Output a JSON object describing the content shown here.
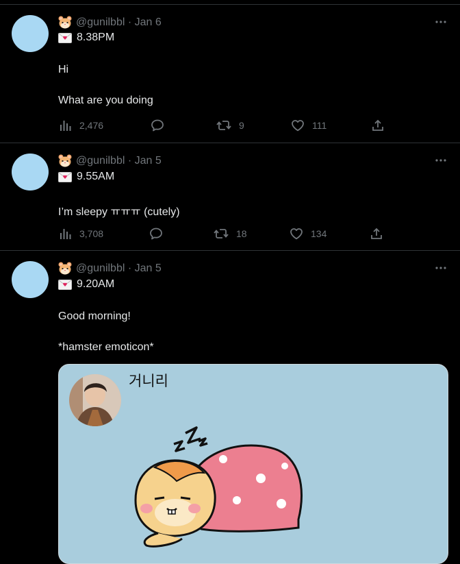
{
  "tweets": [
    {
      "handle": "@gunilbbl",
      "date": "Jan 6",
      "time": "8.38PM",
      "paragraphs": [
        "Hi",
        "What are you doing"
      ],
      "views": "2,476",
      "retweets": "9",
      "likes": "111"
    },
    {
      "handle": "@gunilbbl",
      "date": "Jan 5",
      "time": "9.55AM",
      "paragraphs": [
        "I’m sleepy ㅠㅠㅠ (cutely)"
      ],
      "views": "3,708",
      "retweets": "18",
      "likes": "134"
    },
    {
      "handle": "@gunilbbl",
      "date": "Jan 5",
      "time": "9.20AM",
      "paragraphs": [
        "Good morning!",
        "*hamster emoticon*"
      ],
      "media": {
        "name": "거니리"
      }
    }
  ],
  "icons": {
    "author_emoji": "hamster-face-icon",
    "time_emoji": "love-letter-icon",
    "views": "bar-chart-icon",
    "reply": "speech-bubble-icon",
    "retweet": "retweet-arrows-icon",
    "like": "heart-icon",
    "share": "share-upload-icon",
    "more": "ellipsis-icon"
  },
  "colors": {
    "background": "#000000",
    "divider": "#2f3336",
    "muted_text": "#71767b",
    "primary_text": "#e7e9ea",
    "avatar_placeholder": "#a9d8f3",
    "media_background": "#a9cddd"
  }
}
